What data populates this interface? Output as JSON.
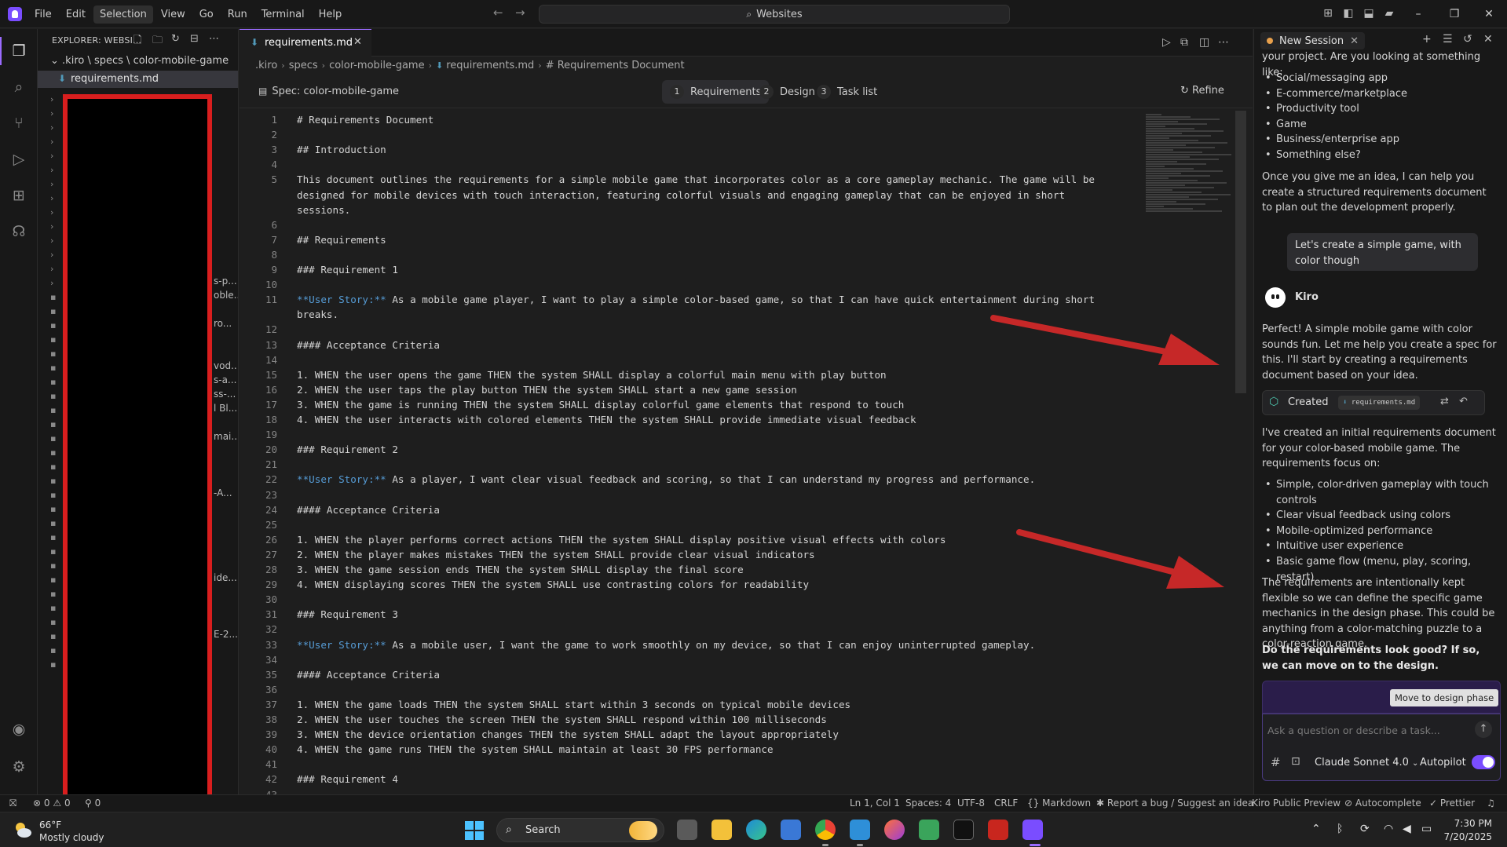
{
  "titlebar": {
    "menu": [
      "File",
      "Edit",
      "Selection",
      "View",
      "Go",
      "Run",
      "Terminal",
      "Help"
    ],
    "active_menu": "Selection",
    "command_center": "Websites"
  },
  "sidebar": {
    "header": "EXPLORER: WEBSI...",
    "root_path": ".kiro \\ specs \\ color-mobile-game",
    "open_file": "requirements.md",
    "fragments": [
      "s-p...",
      "oble...",
      "ro...",
      "vod...",
      "s-a...",
      "ss-...",
      "l Bl...",
      "mai...",
      "-A...",
      "ide...",
      "E-2..."
    ]
  },
  "editor": {
    "tab_label": "requirements.md",
    "breadcrumb": [
      ".kiro",
      "specs",
      "color-mobile-game",
      "requirements.md",
      "# Requirements Document"
    ],
    "spec_title": "Spec: color-mobile-game",
    "spec_tabs": [
      {
        "num": "1",
        "label": "Requirements"
      },
      {
        "num": "2",
        "label": "Design"
      },
      {
        "num": "3",
        "label": "Task list"
      }
    ],
    "refine_label": "Refine",
    "lines": [
      {
        "n": "1",
        "t": "# Requirements Document"
      },
      {
        "n": "2",
        "t": ""
      },
      {
        "n": "3",
        "t": "## Introduction"
      },
      {
        "n": "4",
        "t": ""
      },
      {
        "n": "5",
        "t": "This document outlines the requirements for a simple mobile game that incorporates color as a core gameplay mechanic. The game will be"
      },
      {
        "n": "",
        "t": "designed for mobile devices with touch interaction, featuring colorful visuals and engaging gameplay that can be enjoyed in short"
      },
      {
        "n": "",
        "t": "sessions."
      },
      {
        "n": "6",
        "t": ""
      },
      {
        "n": "7",
        "t": "## Requirements"
      },
      {
        "n": "8",
        "t": ""
      },
      {
        "n": "9",
        "t": "### Requirement 1"
      },
      {
        "n": "10",
        "t": ""
      },
      {
        "n": "11",
        "h": "**User Story:**",
        "t": " As a mobile game player, I want to play a simple color-based game, so that I can have quick entertainment during short"
      },
      {
        "n": "",
        "t": "breaks."
      },
      {
        "n": "12",
        "t": ""
      },
      {
        "n": "13",
        "t": "#### Acceptance Criteria"
      },
      {
        "n": "14",
        "t": ""
      },
      {
        "n": "15",
        "t": "1. WHEN the user opens the game THEN the system SHALL display a colorful main menu with play button"
      },
      {
        "n": "16",
        "t": "2. WHEN the user taps the play button THEN the system SHALL start a new game session"
      },
      {
        "n": "17",
        "t": "3. WHEN the game is running THEN the system SHALL display colorful game elements that respond to touch"
      },
      {
        "n": "18",
        "t": "4. WHEN the user interacts with colored elements THEN the system SHALL provide immediate visual feedback"
      },
      {
        "n": "19",
        "t": ""
      },
      {
        "n": "20",
        "t": "### Requirement 2"
      },
      {
        "n": "21",
        "t": ""
      },
      {
        "n": "22",
        "h": "**User Story:**",
        "t": " As a player, I want clear visual feedback and scoring, so that I can understand my progress and performance."
      },
      {
        "n": "23",
        "t": ""
      },
      {
        "n": "24",
        "t": "#### Acceptance Criteria"
      },
      {
        "n": "25",
        "t": ""
      },
      {
        "n": "26",
        "t": "1. WHEN the player performs correct actions THEN the system SHALL display positive visual effects with colors"
      },
      {
        "n": "27",
        "t": "2. WHEN the player makes mistakes THEN the system SHALL provide clear visual indicators"
      },
      {
        "n": "28",
        "t": "3. WHEN the game session ends THEN the system SHALL display the final score"
      },
      {
        "n": "29",
        "t": "4. WHEN displaying scores THEN the system SHALL use contrasting colors for readability"
      },
      {
        "n": "30",
        "t": ""
      },
      {
        "n": "31",
        "t": "### Requirement 3"
      },
      {
        "n": "32",
        "t": ""
      },
      {
        "n": "33",
        "h": "**User Story:**",
        "t": " As a mobile user, I want the game to work smoothly on my device, so that I can enjoy uninterrupted gameplay."
      },
      {
        "n": "34",
        "t": ""
      },
      {
        "n": "35",
        "t": "#### Acceptance Criteria"
      },
      {
        "n": "36",
        "t": ""
      },
      {
        "n": "37",
        "t": "1. WHEN the game loads THEN the system SHALL start within 3 seconds on typical mobile devices"
      },
      {
        "n": "38",
        "t": "2. WHEN the user touches the screen THEN the system SHALL respond within 100 milliseconds"
      },
      {
        "n": "39",
        "t": "3. WHEN the device orientation changes THEN the system SHALL adapt the layout appropriately"
      },
      {
        "n": "40",
        "t": "4. WHEN the game runs THEN the system SHALL maintain at least 30 FPS performance"
      },
      {
        "n": "41",
        "t": ""
      },
      {
        "n": "42",
        "t": "### Requirement 4"
      },
      {
        "n": "43",
        "t": ""
      }
    ]
  },
  "chat": {
    "session_label": "New Session",
    "intro": "your project. Are you looking at something like:",
    "options": [
      "Social/messaging app",
      "E-commerce/marketplace",
      "Productivity tool",
      "Game",
      "Business/enterprise app",
      "Something else?"
    ],
    "offer": "Once you give me an idea, I can help you create a structured requirements document to plan out the development properly.",
    "user_message": "Let's create a simple game, with color though",
    "agent_name": "Kiro",
    "reply1": "Perfect! A simple mobile game with color sounds fun. Let me help you create a spec for this. I'll start by creating a requirements document based on your idea.",
    "created_label": "Created",
    "created_file": "requirements.md",
    "reply2": "I've created an initial requirements document for your color-based mobile game. The requirements focus on:",
    "focus": [
      "Simple, color-driven gameplay with touch controls",
      "Clear visual feedback using colors",
      "Mobile-optimized performance",
      "Intuitive user experience",
      "Basic game flow (menu, play, scoring, restart)"
    ],
    "reply3": "The requirements are intentionally kept flexible so we can define the specific game mechanics in the design phase. This could be anything from a color-matching puzzle to a color-reaction game.",
    "question": "Do the requirements look good? If so, we can move on to the design.",
    "move_button": "Move to design phase",
    "input_placeholder": "Ask a question or describe a task...",
    "model": "Claude Sonnet 4.0",
    "autopilot": "Autopilot"
  },
  "statusbar": {
    "errors": "0",
    "warnings": "0",
    "ports": "0",
    "cursor": "Ln 1, Col 1",
    "spaces": "Spaces: 4",
    "encoding": "UTF-8",
    "eol": "CRLF",
    "language": "Markdown",
    "report": "Report a bug / Suggest an idea",
    "preview": "Kiro Public Preview",
    "autocomplete": "Autocomplete",
    "prettier": "Prettier"
  },
  "taskbar": {
    "temp": "66°F",
    "weather": "Mostly cloudy",
    "search": "Search",
    "time": "7:30 PM",
    "date": "7/20/2025"
  },
  "colors": {
    "accent": "#7a4dff",
    "annotation_red": "#c62828",
    "heading_blue": "#569cd6"
  }
}
